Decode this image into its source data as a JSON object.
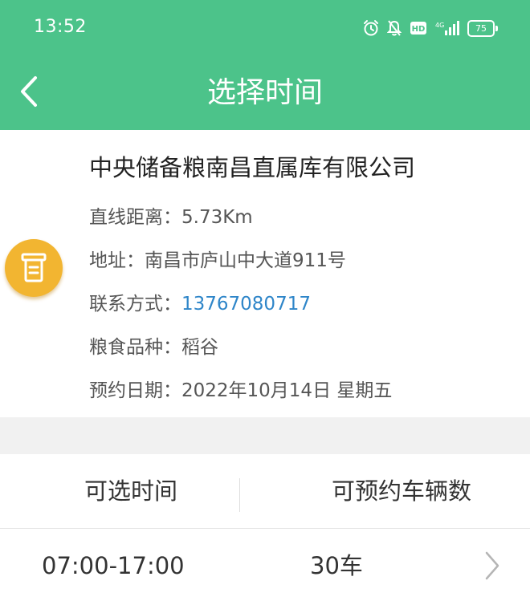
{
  "status_bar": {
    "time": "13:52",
    "battery_level": "75",
    "icons": [
      "alarm-icon",
      "notification-muted-icon",
      "hd-icon",
      "signal-icon",
      "battery-icon"
    ]
  },
  "nav": {
    "title": "选择时间",
    "back_icon": "chevron-left-icon"
  },
  "depot": {
    "name": "中央储备粮南昌直属库有限公司",
    "icon": "depot-icon",
    "distance_label": "直线距离：",
    "distance_value": "5.73Km",
    "address_label": "地址：",
    "address_value": "南昌市庐山中大道911号",
    "contact_label": "联系方式：",
    "contact_value": "13767080717",
    "grain_label": "粮食品种：",
    "grain_value": "稻谷",
    "date_label": "预约日期：",
    "date_value": "2022年10月14日 星期五"
  },
  "slots_table": {
    "headers": {
      "time": "可选时间",
      "vehicles": "可预约车辆数"
    },
    "rows": [
      {
        "time": "07:00-17:00",
        "vehicles": "30车"
      }
    ]
  },
  "colors": {
    "header_green": "#4cc38a",
    "icon_orange": "#f2b531",
    "link_blue": "#2f86c9",
    "band_gray": "#f1f1f1"
  }
}
